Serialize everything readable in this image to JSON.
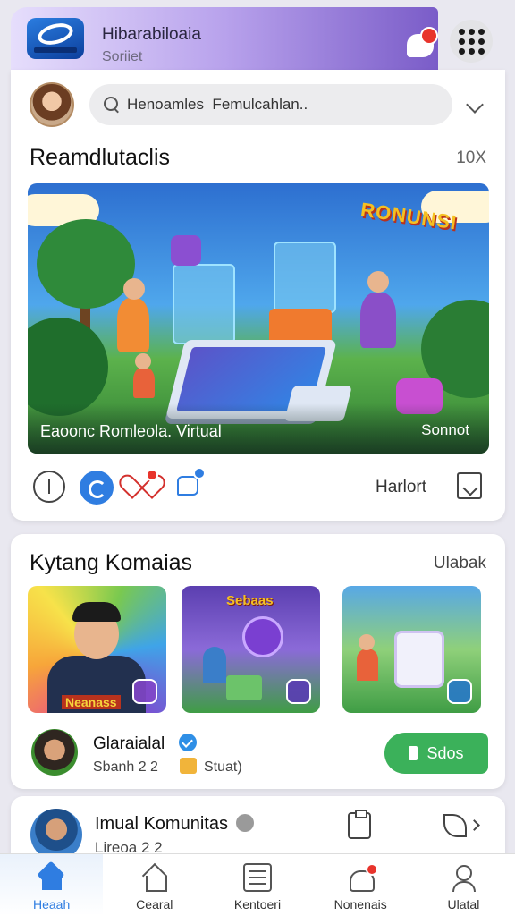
{
  "header": {
    "app_title": "Hibarabiloaia",
    "app_subtitle": "Soriiet"
  },
  "search": {
    "placeholder": "Henoamles  Femulcahlan..",
    "value": ""
  },
  "feed": {
    "section_title": "Reamdlutaclis",
    "section_count": "10X",
    "hero_badge": "RONUNSI",
    "hero_caption": "Eaoonc Romleola. Virtual",
    "hero_action": "Sonnot",
    "action_label": "Harlort"
  },
  "community": {
    "title": "Kytang Komaias",
    "action": "Ulabak",
    "thumb_1_label": "Neanass",
    "thumb_2_banner": "Sebaas",
    "author_name": "Glaraialal",
    "author_meta": "Sbanh 2 2",
    "author_meta_2": "Stuat)",
    "join_label": "Sdos"
  },
  "group": {
    "name": "Imual Komunitas",
    "meta": "Lireoa  2  2"
  },
  "nav": {
    "items": [
      {
        "label": "Heaah"
      },
      {
        "label": "Cearal"
      },
      {
        "label": "Kentoeri"
      },
      {
        "label": "Nonenais"
      },
      {
        "label": "Ulatal"
      }
    ]
  },
  "colors": {
    "accent": "#2f7de1",
    "success": "#3bb15a",
    "notification": "#e8342c",
    "header_gradient_end": "#7a5cc8"
  }
}
